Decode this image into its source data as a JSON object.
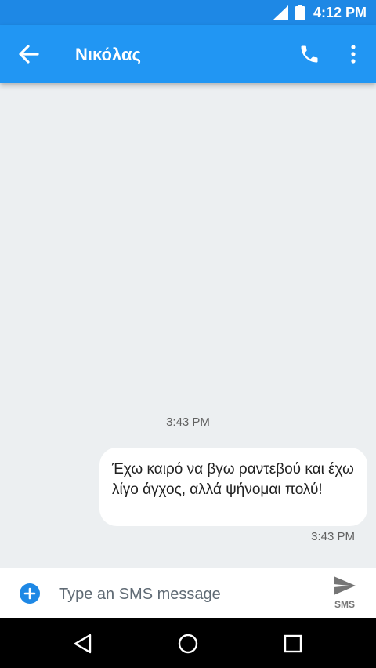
{
  "status_bar": {
    "time": "4:12 PM",
    "icons": [
      "cell-signal-icon",
      "battery-icon"
    ]
  },
  "app_bar": {
    "title": "Νικόλας",
    "icons": [
      "arrow-back-icon",
      "phone-icon",
      "more-vert-icon"
    ]
  },
  "conversation": {
    "divider_time": "3:43 PM",
    "messages": [
      {
        "text": "Έχω καιρό να βγω ραντεβού και έχω λίγο άγχος, αλλά ψήνομαι πολύ!",
        "time": "3:43 PM",
        "direction": "outgoing"
      }
    ]
  },
  "compose": {
    "placeholder": "Type an SMS message",
    "send_label": "SMS",
    "icons": [
      "add-circle-icon",
      "send-icon"
    ]
  },
  "nav_bar": {
    "icons": [
      "back-triangle-icon",
      "home-circle-icon",
      "recents-square-icon"
    ]
  },
  "colors": {
    "status_bar": "#1e88e5",
    "app_bar": "#2196f3",
    "background": "#eceff1",
    "bubble": "#ffffff",
    "accent": "#1e88e5"
  }
}
